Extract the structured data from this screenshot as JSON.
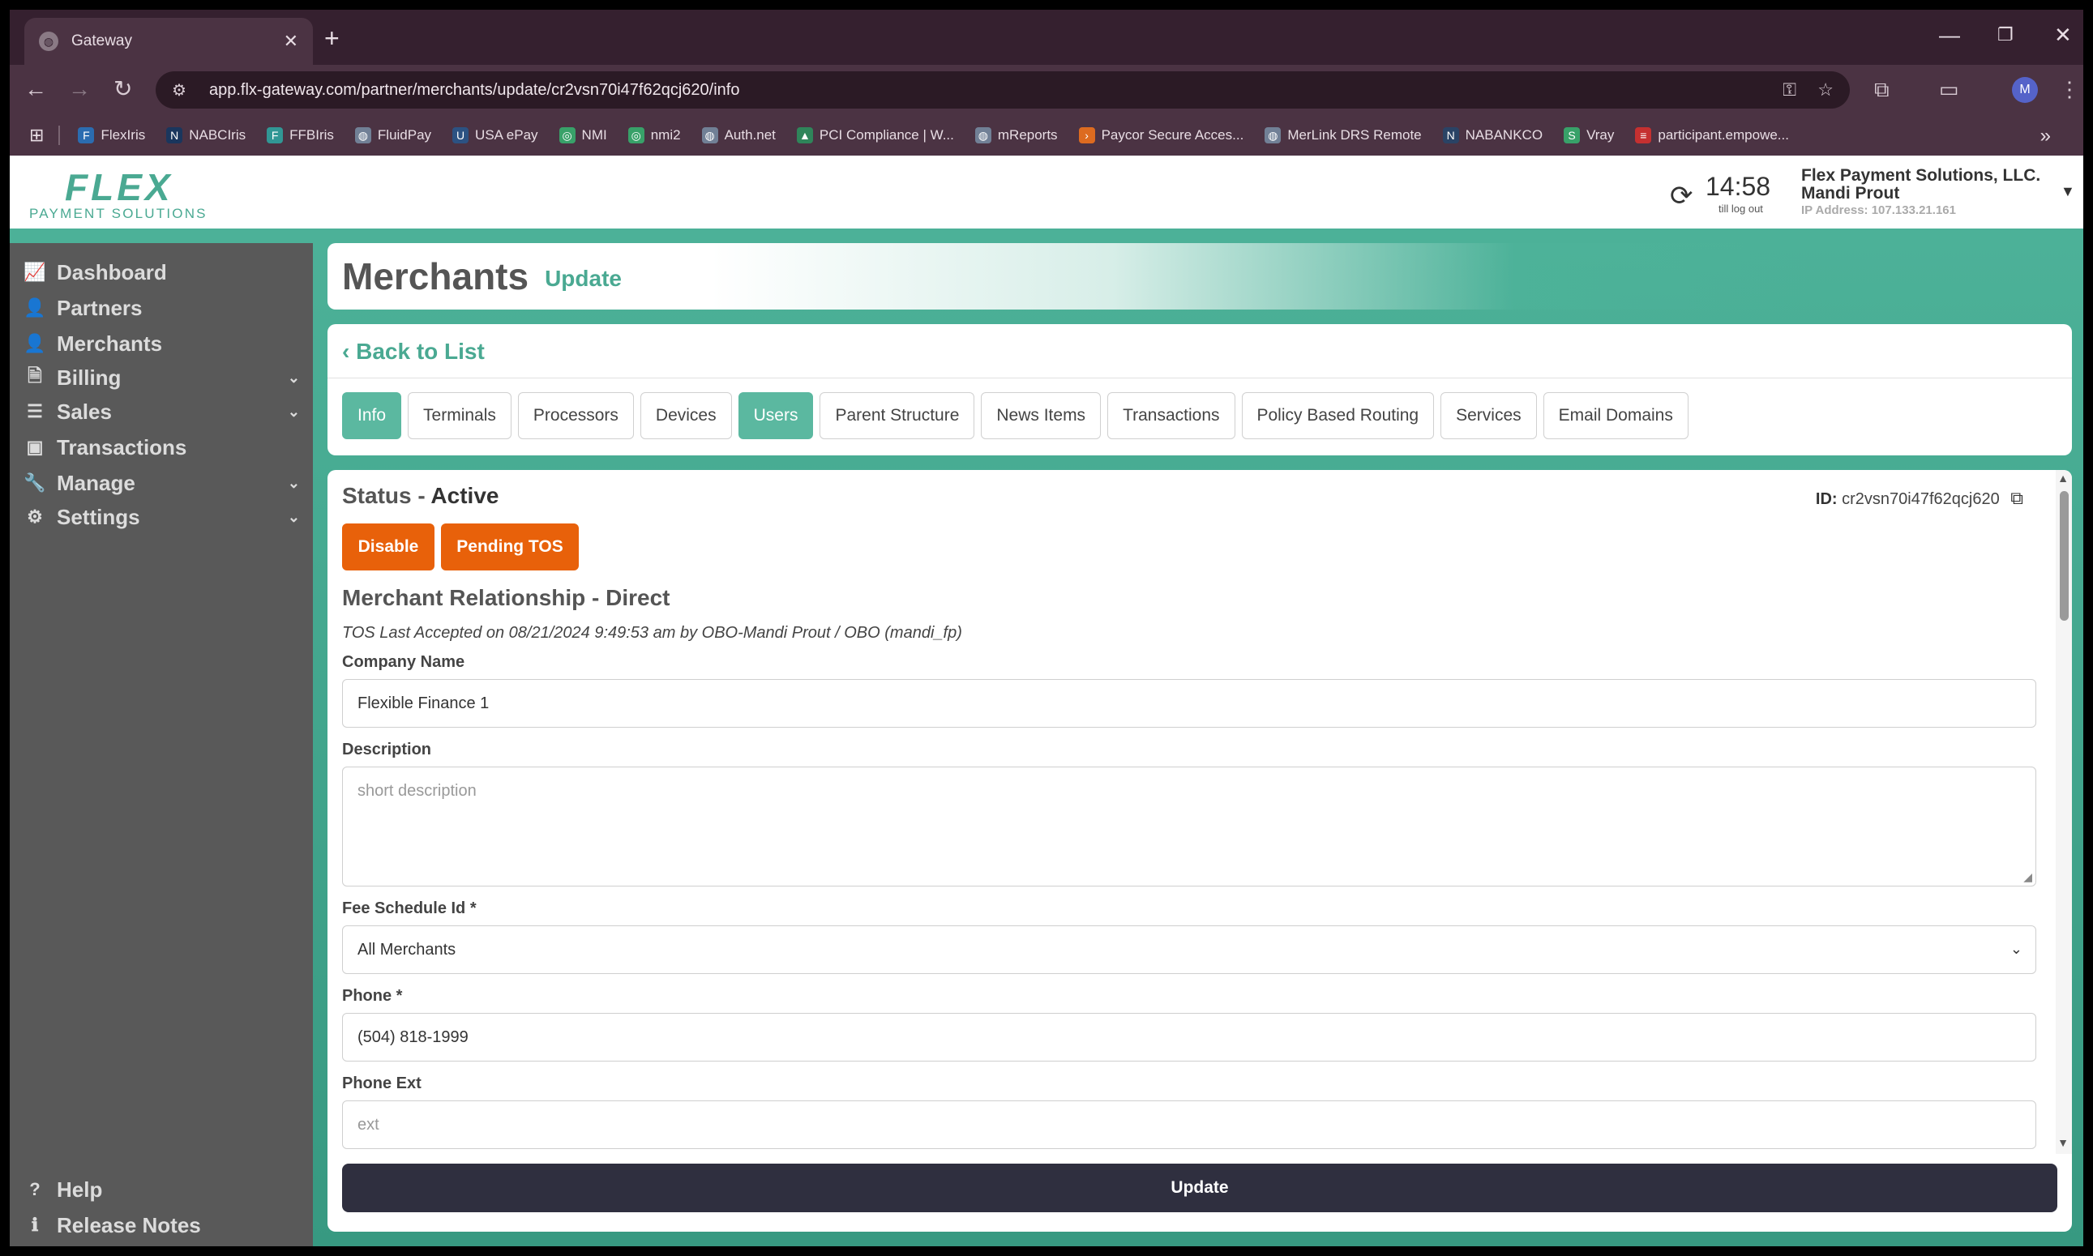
{
  "browser": {
    "tab_title": "Gateway",
    "url": "app.flx-gateway.com/partner/merchants/update/cr2vsn70i47f62qcj620/info",
    "profile_initial": "M",
    "bookmarks": [
      {
        "label": "FlexIris",
        "color": "#2b6cb0",
        "glyph": "F"
      },
      {
        "label": "NABCIris",
        "color": "#1a365d",
        "glyph": "N"
      },
      {
        "label": "FFBIris",
        "color": "#319795",
        "glyph": "F"
      },
      {
        "label": "FluidPay",
        "color": "#718096",
        "glyph": "◍"
      },
      {
        "label": "USA ePay",
        "color": "#2c5282",
        "glyph": "U"
      },
      {
        "label": "NMI",
        "color": "#38a169",
        "glyph": "◎"
      },
      {
        "label": "nmi2",
        "color": "#38a169",
        "glyph": "◎"
      },
      {
        "label": "Auth.net",
        "color": "#718096",
        "glyph": "◍"
      },
      {
        "label": "PCI Compliance | W...",
        "color": "#2f855a",
        "glyph": "▲"
      },
      {
        "label": "mReports",
        "color": "#718096",
        "glyph": "◍"
      },
      {
        "label": "Paycor Secure Acces...",
        "color": "#dd6b20",
        "glyph": "›"
      },
      {
        "label": "MerLink DRS Remote",
        "color": "#718096",
        "glyph": "◍"
      },
      {
        "label": "NABANKCO",
        "color": "#2a4365",
        "glyph": "N"
      },
      {
        "label": "Vray",
        "color": "#38a169",
        "glyph": "S"
      },
      {
        "label": "participant.empowe...",
        "color": "#c53030",
        "glyph": "≡"
      }
    ]
  },
  "header": {
    "logo_main": "FLEX",
    "logo_sub": "PAYMENT SOLUTIONS",
    "session_time": "14:58",
    "session_sub": "till log out",
    "company": "Flex Payment Solutions, LLC.",
    "user": "Mandi Prout",
    "ip": "IP Address: 107.133.21.161"
  },
  "sidebar": {
    "items": [
      {
        "label": "Dashboard",
        "icon": "chart-line-icon",
        "glyph": "📈",
        "has_chevron": false
      },
      {
        "label": "Partners",
        "icon": "user-icon",
        "glyph": "👤",
        "has_chevron": false
      },
      {
        "label": "Merchants",
        "icon": "user-icon",
        "glyph": "👤",
        "has_chevron": false
      },
      {
        "label": "Billing",
        "icon": "file-icon",
        "glyph": "🗎",
        "has_chevron": true
      },
      {
        "label": "Sales",
        "icon": "list-icon",
        "glyph": "☰",
        "has_chevron": true
      },
      {
        "label": "Transactions",
        "icon": "money-icon",
        "glyph": "▣",
        "has_chevron": false
      },
      {
        "label": "Manage",
        "icon": "wrench-icon",
        "glyph": "🔧",
        "has_chevron": true
      },
      {
        "label": "Settings",
        "icon": "gear-icon",
        "glyph": "⚙",
        "has_chevron": true
      }
    ],
    "bottom": [
      {
        "label": "Help",
        "icon": "question-icon",
        "glyph": "?"
      },
      {
        "label": "Release Notes",
        "icon": "info-icon",
        "glyph": "ℹ"
      }
    ]
  },
  "page": {
    "title": "Merchants",
    "subtitle": "Update",
    "back_label": "Back to List",
    "tabs": [
      {
        "label": "Info",
        "active": true
      },
      {
        "label": "Terminals",
        "active": false
      },
      {
        "label": "Processors",
        "active": false
      },
      {
        "label": "Devices",
        "active": false
      },
      {
        "label": "Users",
        "active": true
      },
      {
        "label": "Parent Structure",
        "active": false
      },
      {
        "label": "News Items",
        "active": false
      },
      {
        "label": "Transactions",
        "active": false
      },
      {
        "label": "Policy Based Routing",
        "active": false
      },
      {
        "label": "Services",
        "active": false
      },
      {
        "label": "Email Domains",
        "active": false
      }
    ]
  },
  "form": {
    "status_prefix": "Status - ",
    "status_value": "Active",
    "id_label": "ID:",
    "id_value": "cr2vsn70i47f62qcj620",
    "disable_label": "Disable",
    "pending_tos_label": "Pending TOS",
    "relationship": "Merchant Relationship - Direct",
    "tos_text": "TOS Last Accepted on 08/21/2024 9:49:53 am by OBO-Mandi Prout / OBO (mandi_fp)",
    "company_name_label": "Company Name",
    "company_name_value": "Flexible Finance 1",
    "description_label": "Description",
    "description_placeholder": "short description",
    "fee_schedule_label": "Fee Schedule Id *",
    "fee_schedule_value": "All Merchants",
    "phone_label": "Phone *",
    "phone_value": "(504) 818-1999",
    "phone_ext_label": "Phone Ext",
    "phone_ext_placeholder": "ext",
    "update_label": "Update"
  },
  "colors": {
    "accent": "#4aa992",
    "tab_active": "#5bb8a0",
    "orange": "#e8610a",
    "update_button": "#2f2f3f",
    "sidebar": "#595959"
  }
}
